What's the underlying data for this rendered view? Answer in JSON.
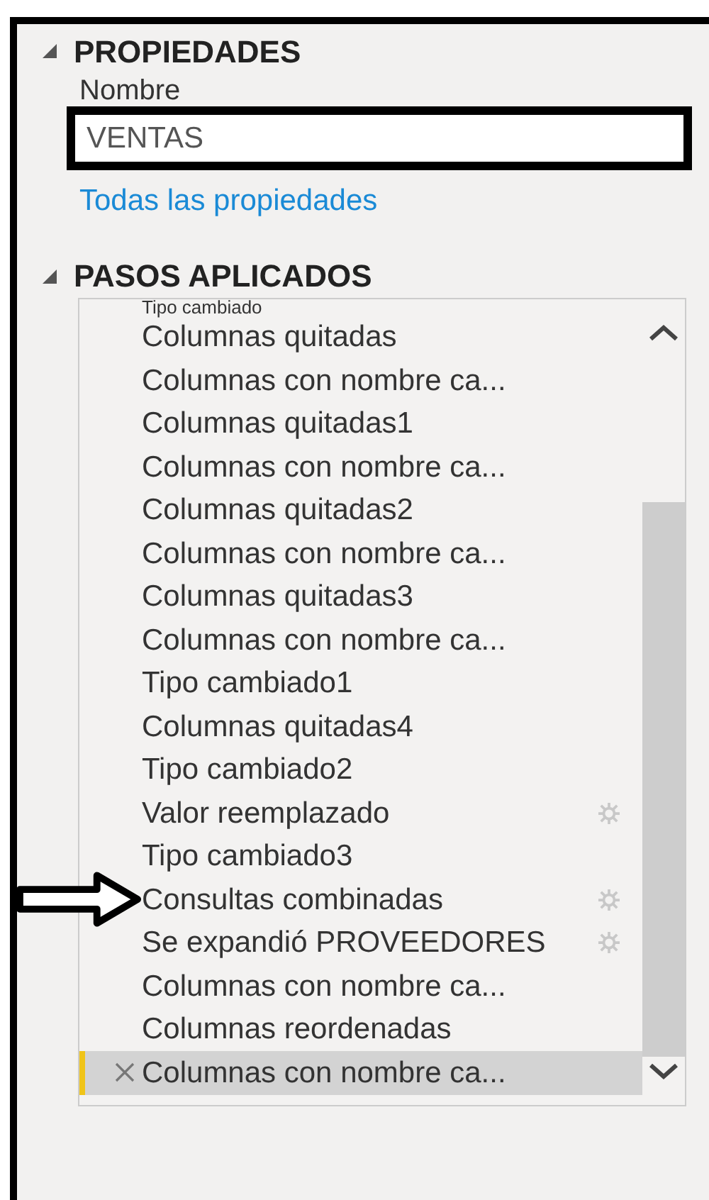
{
  "properties": {
    "title": "PROPIEDADES",
    "expanded": true,
    "name_label": "Nombre",
    "name_value": "VENTAS",
    "link": "Todas las propiedades"
  },
  "applied_steps": {
    "title": "PASOS APLICADOS",
    "expanded": true,
    "steps": [
      {
        "label": "Tipo cambiado",
        "settings": false,
        "selected": false,
        "arrow": false
      },
      {
        "label": "Columnas quitadas",
        "settings": false,
        "selected": false,
        "arrow": false
      },
      {
        "label": "Columnas con nombre ca...",
        "settings": false,
        "selected": false,
        "arrow": false
      },
      {
        "label": "Columnas quitadas1",
        "settings": false,
        "selected": false,
        "arrow": false
      },
      {
        "label": "Columnas con nombre ca...",
        "settings": false,
        "selected": false,
        "arrow": false
      },
      {
        "label": "Columnas quitadas2",
        "settings": false,
        "selected": false,
        "arrow": false
      },
      {
        "label": "Columnas con nombre ca...",
        "settings": false,
        "selected": false,
        "arrow": false
      },
      {
        "label": "Columnas quitadas3",
        "settings": false,
        "selected": false,
        "arrow": false
      },
      {
        "label": "Columnas con nombre ca...",
        "settings": false,
        "selected": false,
        "arrow": false
      },
      {
        "label": "Tipo cambiado1",
        "settings": false,
        "selected": false,
        "arrow": false
      },
      {
        "label": "Columnas quitadas4",
        "settings": false,
        "selected": false,
        "arrow": false
      },
      {
        "label": "Tipo cambiado2",
        "settings": false,
        "selected": false,
        "arrow": false
      },
      {
        "label": "Valor reemplazado",
        "settings": true,
        "selected": false,
        "arrow": false
      },
      {
        "label": "Tipo cambiado3",
        "settings": false,
        "selected": false,
        "arrow": false
      },
      {
        "label": "Consultas combinadas",
        "settings": true,
        "selected": false,
        "arrow": true
      },
      {
        "label": "Se expandió PROVEEDORES",
        "settings": true,
        "selected": false,
        "arrow": false
      },
      {
        "label": "Columnas con nombre ca...",
        "settings": false,
        "selected": false,
        "arrow": false
      },
      {
        "label": "Columnas reordenadas",
        "settings": false,
        "selected": false,
        "arrow": false
      },
      {
        "label": "Columnas con nombre ca...",
        "settings": false,
        "selected": true,
        "arrow": false
      }
    ]
  }
}
